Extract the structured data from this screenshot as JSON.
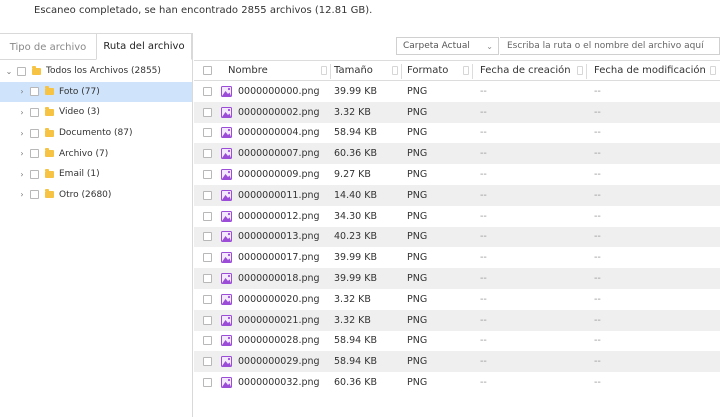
{
  "status": "Escaneo completado, se han encontrado 2855 archivos (12.81 GB).",
  "tabs": [
    "Tipo de archivo",
    "Ruta del archivo"
  ],
  "tree": {
    "root": "Todos los Archivos (2855)",
    "items": [
      "Foto (77)",
      "Video (3)",
      "Documento (87)",
      "Archivo (7)",
      "Email (1)",
      "Otro (2680)"
    ]
  },
  "toolbar": {
    "scope": "Carpeta Actual",
    "path_placeholder": "Escriba la ruta o el nombre del archivo aquí"
  },
  "table": {
    "headers": [
      "Nombre",
      "Tamaño",
      "Formato",
      "Fecha de creación",
      "Fecha de modificación"
    ],
    "rows": [
      {
        "name": "0000000000.png",
        "size": "39.99 KB",
        "format": "PNG",
        "created": "--",
        "modified": "--"
      },
      {
        "name": "0000000002.png",
        "size": "3.32 KB",
        "format": "PNG",
        "created": "--",
        "modified": "--"
      },
      {
        "name": "0000000004.png",
        "size": "58.94 KB",
        "format": "PNG",
        "created": "--",
        "modified": "--"
      },
      {
        "name": "0000000007.png",
        "size": "60.36 KB",
        "format": "PNG",
        "created": "--",
        "modified": "--"
      },
      {
        "name": "0000000009.png",
        "size": "9.27 KB",
        "format": "PNG",
        "created": "--",
        "modified": "--"
      },
      {
        "name": "0000000011.png",
        "size": "14.40 KB",
        "format": "PNG",
        "created": "--",
        "modified": "--"
      },
      {
        "name": "0000000012.png",
        "size": "34.30 KB",
        "format": "PNG",
        "created": "--",
        "modified": "--"
      },
      {
        "name": "0000000013.png",
        "size": "40.23 KB",
        "format": "PNG",
        "created": "--",
        "modified": "--"
      },
      {
        "name": "0000000017.png",
        "size": "39.99 KB",
        "format": "PNG",
        "created": "--",
        "modified": "--"
      },
      {
        "name": "0000000018.png",
        "size": "39.99 KB",
        "format": "PNG",
        "created": "--",
        "modified": "--"
      },
      {
        "name": "0000000020.png",
        "size": "3.32 KB",
        "format": "PNG",
        "created": "--",
        "modified": "--"
      },
      {
        "name": "0000000021.png",
        "size": "3.32 KB",
        "format": "PNG",
        "created": "--",
        "modified": "--"
      },
      {
        "name": "0000000028.png",
        "size": "58.94 KB",
        "format": "PNG",
        "created": "--",
        "modified": "--"
      },
      {
        "name": "0000000029.png",
        "size": "58.94 KB",
        "format": "PNG",
        "created": "--",
        "modified": "--"
      },
      {
        "name": "0000000032.png",
        "size": "60.36 KB",
        "format": "PNG",
        "created": "--",
        "modified": "--"
      }
    ]
  },
  "colors": {
    "selected_row": "#cfe3fa",
    "alt_row": "#efefef",
    "folder": "#f6c344",
    "image_icon": "#9b4dd8"
  },
  "icons": {
    "file": "image-file-icon",
    "folder": "folder-icon",
    "expand": "chevron-right-icon",
    "dropdown": "chevron-down-icon"
  }
}
